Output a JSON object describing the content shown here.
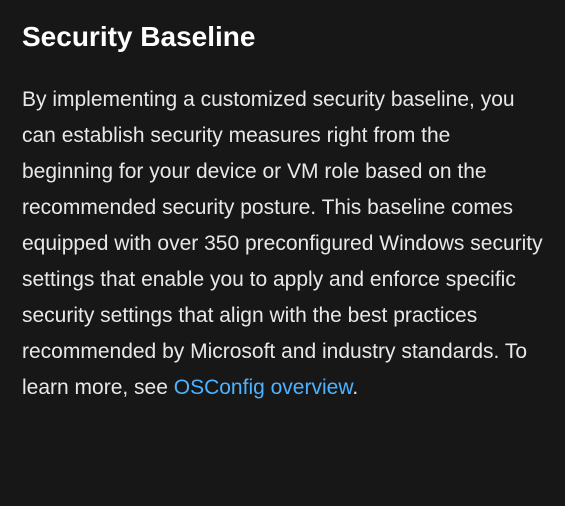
{
  "heading": "Security Baseline",
  "paragraph": {
    "text_before_link": "By implementing a customized security baseline, you can establish security measures right from the beginning for your device or VM role based on the recommended security posture. This baseline comes equipped with over 350 preconfigured Windows security settings that enable you to apply and enforce specific security settings that align with the best practices recommended by Microsoft and industry standards. To learn more, see ",
    "link_text": "OSConfig overview",
    "text_after_link": "."
  }
}
